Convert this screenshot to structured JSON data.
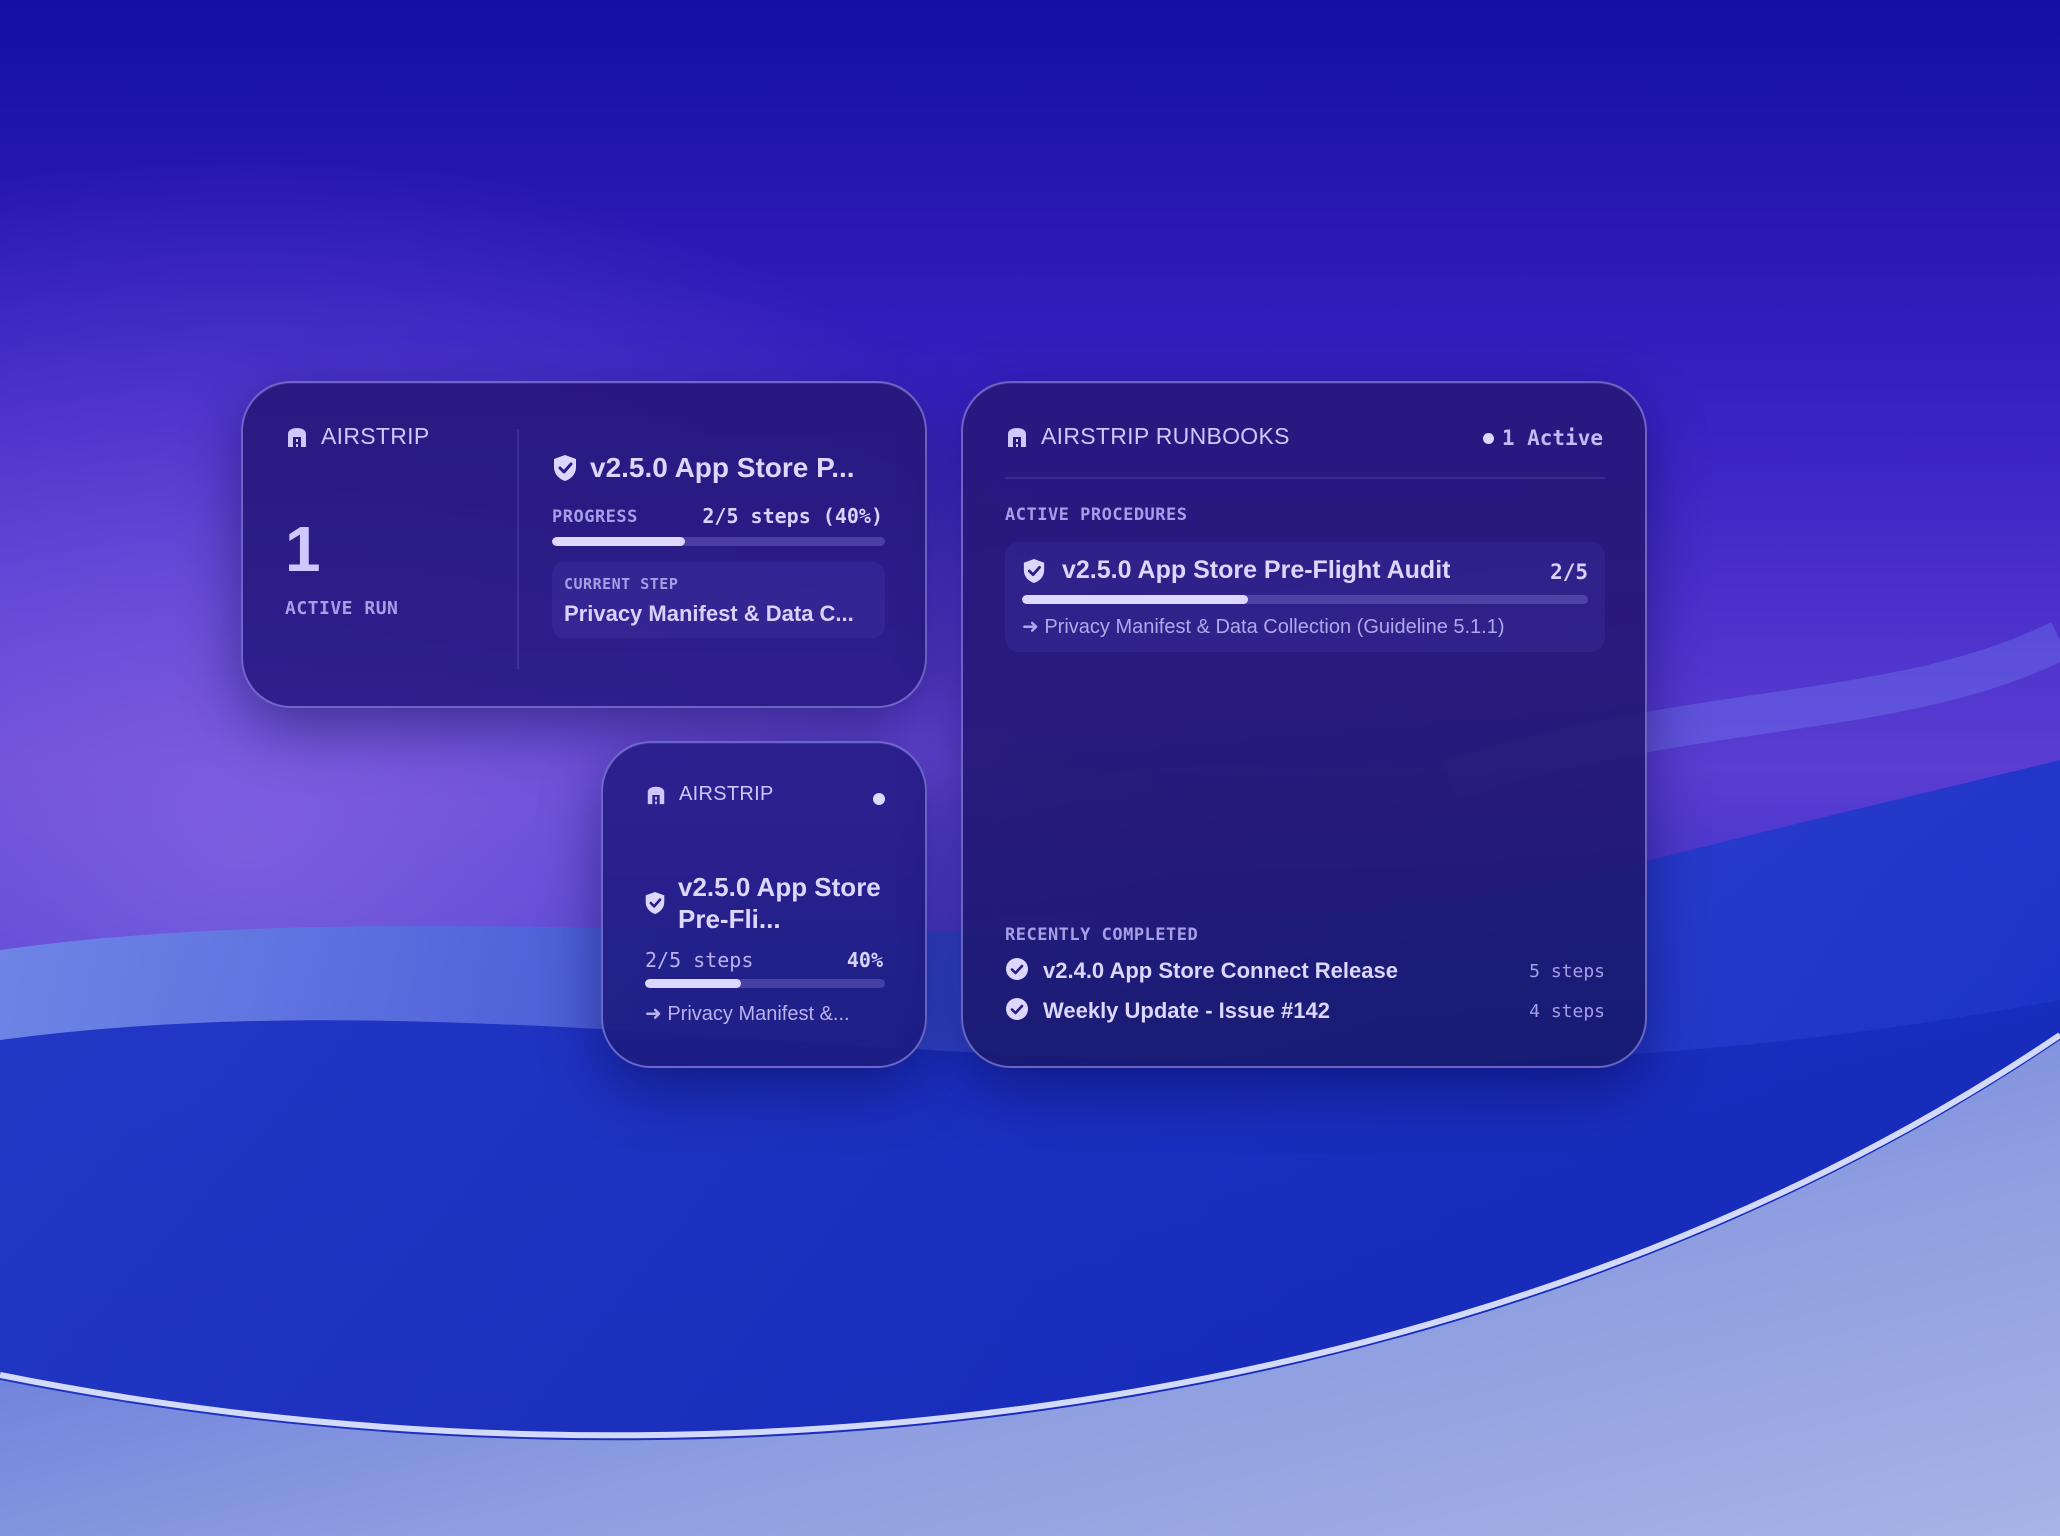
{
  "colors": {
    "background_top": "#150fa3",
    "background_mid": "#6a50d8",
    "widget_bg": "#291a80",
    "text_primary": "#ddd7ff",
    "text_caption": "#a79ee8"
  },
  "icons": {
    "brand": "airstrip-logo-icon",
    "procedure": "shield-check-icon",
    "completed": "check-circle-icon",
    "arrow": "arrow-right-icon"
  },
  "widget_medium": {
    "brand": "AIRSTRIP",
    "active_count": "1",
    "active_label": "ACTIVE RUN",
    "run_title": "v2.5.0 App Store P...",
    "progress_label": "PROGRESS",
    "progress_value": "2/5 steps (40%)",
    "progress_fraction": 0.4,
    "current_step_label": "CURRENT STEP",
    "current_step_value": "Privacy Manifest & Data C..."
  },
  "widget_small": {
    "brand": "AIRSTRIP",
    "run_title": "v2.5.0 App Store Pre-Fli...",
    "steps": "2/5 steps",
    "percent": "40%",
    "progress_fraction": 0.4,
    "current_step": "➜ Privacy Manifest &..."
  },
  "widget_large": {
    "brand": "AIRSTRIP RUNBOOKS",
    "active_badge": "1 Active",
    "active_section_label": "ACTIVE PROCEDURES",
    "procedure": {
      "title": "v2.5.0 App Store Pre-Flight Audit",
      "count": "2/5",
      "progress_fraction": 0.4,
      "current_step": "➜ Privacy Manifest & Data Collection (Guideline 5.1.1)"
    },
    "recent_section_label": "RECENTLY COMPLETED",
    "recent": [
      {
        "name": "v2.4.0 App Store Connect Release",
        "steps": "5 steps"
      },
      {
        "name": "Weekly Update - Issue #142",
        "steps": "4 steps"
      }
    ]
  }
}
